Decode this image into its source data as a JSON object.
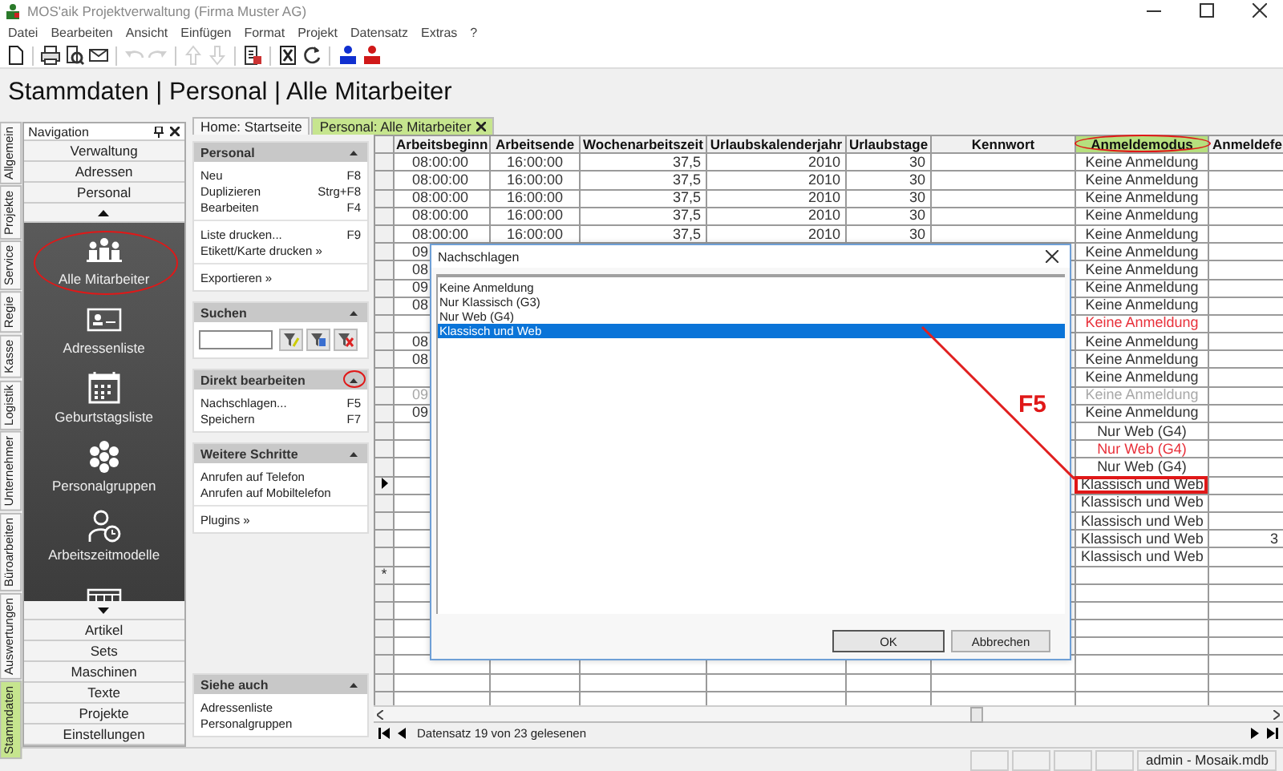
{
  "window": {
    "title": "MOS'aik Projektverwaltung (Firma Muster AG)"
  },
  "menu": [
    "Datei",
    "Bearbeiten",
    "Ansicht",
    "Einfügen",
    "Format",
    "Projekt",
    "Datensatz",
    "Extras",
    "?"
  ],
  "toolbar": [
    [
      {
        "kind": "new",
        "disabled": false
      }
    ],
    [
      {
        "kind": "print",
        "disabled": false
      },
      {
        "kind": "preview",
        "disabled": false
      },
      {
        "kind": "mail",
        "disabled": false
      }
    ],
    [
      {
        "kind": "undo",
        "disabled": true
      },
      {
        "kind": "redo",
        "disabled": true
      }
    ],
    [
      {
        "kind": "up",
        "disabled": true
      },
      {
        "kind": "down",
        "disabled": true
      }
    ],
    [
      {
        "kind": "page",
        "disabled": false
      }
    ],
    [
      {
        "kind": "cancel",
        "disabled": false
      },
      {
        "kind": "refresh",
        "disabled": false
      }
    ],
    [
      {
        "kind": "user-blue",
        "disabled": false
      },
      {
        "kind": "user-red",
        "disabled": false
      }
    ]
  ],
  "breadcrumb": "Stammdaten | Personal | Alle Mitarbeiter",
  "side_tabs": [
    {
      "label": "Allgemein",
      "selected": false
    },
    {
      "label": "Projekte",
      "selected": false
    },
    {
      "label": "Service",
      "selected": false
    },
    {
      "label": "Regie",
      "selected": false
    },
    {
      "label": "Kasse",
      "selected": false
    },
    {
      "label": "Logistik",
      "selected": false
    },
    {
      "label": "Unternehmer",
      "selected": false
    },
    {
      "label": "Büroarbeiten",
      "selected": false
    },
    {
      "label": "Auswertungen",
      "selected": false
    },
    {
      "label": "Stammdaten",
      "selected": true
    }
  ],
  "navigation": {
    "title": "Navigation",
    "top_items": [
      "Verwaltung",
      "Adressen",
      "Personal"
    ],
    "large_items": [
      {
        "label": "Alle Mitarbeiter",
        "selected": true
      },
      {
        "label": "Adressenliste",
        "selected": false
      },
      {
        "label": "Geburtstagsliste",
        "selected": false
      },
      {
        "label": "Personalgruppen",
        "selected": false
      },
      {
        "label": "Arbeitszeitmodelle",
        "selected": false
      }
    ],
    "bottom_items": [
      "Artikel",
      "Sets",
      "Maschinen",
      "Texte",
      "Projekte",
      "Einstellungen"
    ]
  },
  "doc_tabs": [
    {
      "label": "Home: Startseite",
      "selected": false
    },
    {
      "label": "Personal: Alle Mitarbeiter",
      "selected": true
    }
  ],
  "task_panel": [
    {
      "title": "Personal",
      "kind": "menu",
      "groups": [
        [
          {
            "label": "Neu",
            "shortcut": "F8"
          },
          {
            "label": "Duplizieren",
            "shortcut": "Strg+F8"
          },
          {
            "label": "Bearbeiten",
            "shortcut": "F4"
          }
        ],
        [
          {
            "label": "Liste drucken...",
            "shortcut": "F9"
          },
          {
            "label": "Etikett/Karte drucken »"
          }
        ],
        [
          {
            "label": "Exportieren »"
          }
        ]
      ]
    },
    {
      "title": "Suchen",
      "kind": "search"
    },
    {
      "title": "Direkt bearbeiten",
      "kind": "menu",
      "groups": [
        [
          {
            "label": "Nachschlagen...",
            "shortcut": "F5"
          },
          {
            "label": "Speichern",
            "shortcut": "F7"
          }
        ]
      ]
    },
    {
      "title": "Weitere Schritte",
      "kind": "menu",
      "groups": [
        [
          {
            "label": "Anrufen auf Telefon"
          },
          {
            "label": "Anrufen auf Mobiltelefon"
          }
        ],
        [
          {
            "label": "Plugins »"
          }
        ]
      ]
    },
    {
      "title": "Siehe auch",
      "kind": "bottom",
      "groups": [
        [
          {
            "label": "Adressenliste"
          },
          {
            "label": "Personalgruppen"
          }
        ]
      ]
    }
  ],
  "table": {
    "columns": [
      {
        "label": "Arbeitsbeginn",
        "highlighted": false
      },
      {
        "label": "Arbeitsende",
        "highlighted": false
      },
      {
        "label": "Wochenarbeitszeit",
        "highlighted": false
      },
      {
        "label": "Urlaubskalenderjahr",
        "highlighted": false
      },
      {
        "label": "Urlaubstage",
        "highlighted": false
      },
      {
        "label": "Kennwort",
        "highlighted": false
      },
      {
        "label": "Anmeldemodus",
        "highlighted": true
      },
      {
        "label": "Anmeldefe",
        "highlighted": false
      }
    ],
    "rows": [
      {
        "current": false,
        "color": "#333333",
        "cells": [
          "08:00:00",
          "16:00:00",
          "37,5",
          "2010",
          "30",
          null,
          "Keine Anmeldung",
          null
        ]
      },
      {
        "current": false,
        "color": "#333333",
        "cells": [
          "08:00:00",
          "16:00:00",
          "37,5",
          "2010",
          "30",
          null,
          "Keine Anmeldung",
          null
        ]
      },
      {
        "current": false,
        "color": "#333333",
        "cells": [
          "08:00:00",
          "16:00:00",
          "37,5",
          "2010",
          "30",
          null,
          "Keine Anmeldung",
          null
        ]
      },
      {
        "current": false,
        "color": "#333333",
        "cells": [
          "08:00:00",
          "16:00:00",
          "37,5",
          "2010",
          "30",
          null,
          "Keine Anmeldung",
          null
        ]
      },
      {
        "current": false,
        "color": "#333333",
        "cells": [
          "08:00:00",
          "16:00:00",
          "37,5",
          "2010",
          "30",
          null,
          "Keine Anmeldung",
          null
        ]
      },
      {
        "current": false,
        "color": "#333333",
        "cells": [
          "09",
          null,
          null,
          null,
          null,
          null,
          "Keine Anmeldung",
          null
        ]
      },
      {
        "current": false,
        "color": "#333333",
        "cells": [
          "08",
          null,
          null,
          null,
          null,
          null,
          "Keine Anmeldung",
          null
        ]
      },
      {
        "current": false,
        "color": "#333333",
        "cells": [
          "09",
          null,
          null,
          null,
          null,
          null,
          "Keine Anmeldung",
          null
        ]
      },
      {
        "current": false,
        "color": "#333333",
        "cells": [
          "08",
          null,
          null,
          null,
          null,
          null,
          "Keine Anmeldung",
          null
        ]
      },
      {
        "current": false,
        "color": "#e8303a",
        "cells": [
          null,
          null,
          null,
          null,
          null,
          null,
          "Keine Anmeldung",
          null
        ]
      },
      {
        "current": false,
        "color": "#333333",
        "cells": [
          "08",
          null,
          null,
          null,
          null,
          null,
          "Keine Anmeldung",
          null
        ]
      },
      {
        "current": false,
        "color": "#333333",
        "cells": [
          "08",
          null,
          null,
          null,
          null,
          null,
          "Keine Anmeldung",
          null
        ]
      },
      {
        "current": false,
        "color": "#333333",
        "cells": [
          null,
          null,
          null,
          null,
          null,
          null,
          "Keine Anmeldung",
          null
        ]
      },
      {
        "current": false,
        "color": "#a8a8a8",
        "cells": [
          "09",
          null,
          null,
          null,
          null,
          null,
          "Keine Anmeldung",
          null
        ]
      },
      {
        "current": false,
        "color": "#333333",
        "cells": [
          "09",
          null,
          null,
          null,
          null,
          null,
          "Keine Anmeldung",
          null
        ]
      },
      {
        "current": false,
        "color": "#333333",
        "cells": [
          null,
          null,
          null,
          null,
          null,
          null,
          "Nur Web (G4)",
          null
        ]
      },
      {
        "current": false,
        "color": "#e8303a",
        "cells": [
          null,
          null,
          null,
          null,
          null,
          null,
          "Nur Web (G4)",
          null
        ]
      },
      {
        "current": false,
        "color": "#333333",
        "cells": [
          null,
          null,
          null,
          null,
          null,
          null,
          "Nur Web (G4)",
          null
        ]
      },
      {
        "current": true,
        "color": "#333333",
        "cells": [
          null,
          null,
          null,
          null,
          null,
          null,
          "Klassisch und Web",
          null
        ]
      },
      {
        "current": false,
        "color": "#333333",
        "cells": [
          null,
          null,
          null,
          null,
          null,
          null,
          "Klassisch und Web",
          null
        ]
      },
      {
        "current": false,
        "color": "#333333",
        "cells": [
          null,
          null,
          null,
          null,
          null,
          null,
          "Klassisch und Web",
          null
        ]
      },
      {
        "current": false,
        "color": "#333333",
        "cells": [
          null,
          null,
          null,
          null,
          null,
          null,
          "Klassisch und Web",
          "3"
        ]
      },
      {
        "current": false,
        "color": "#333333",
        "cells": [
          null,
          null,
          null,
          null,
          null,
          null,
          "Klassisch und Web",
          null
        ]
      }
    ],
    "new_row_marker": "*"
  },
  "dialog": {
    "title": "Nachschlagen",
    "options": [
      {
        "label": "Keine Anmeldung",
        "selected": false
      },
      {
        "label": "Nur Klassisch (G3)",
        "selected": false
      },
      {
        "label": "Nur Web (G4)",
        "selected": false
      },
      {
        "label": "Klassisch und Web",
        "selected": true
      }
    ],
    "buttons": [
      "OK",
      "Abbrechen"
    ]
  },
  "annotation": {
    "label": "F5"
  },
  "navigator": {
    "text": "Datensatz 19 von 23 gelesenen"
  },
  "status_bar": {
    "text": "admin - Mosaik.mdb"
  }
}
